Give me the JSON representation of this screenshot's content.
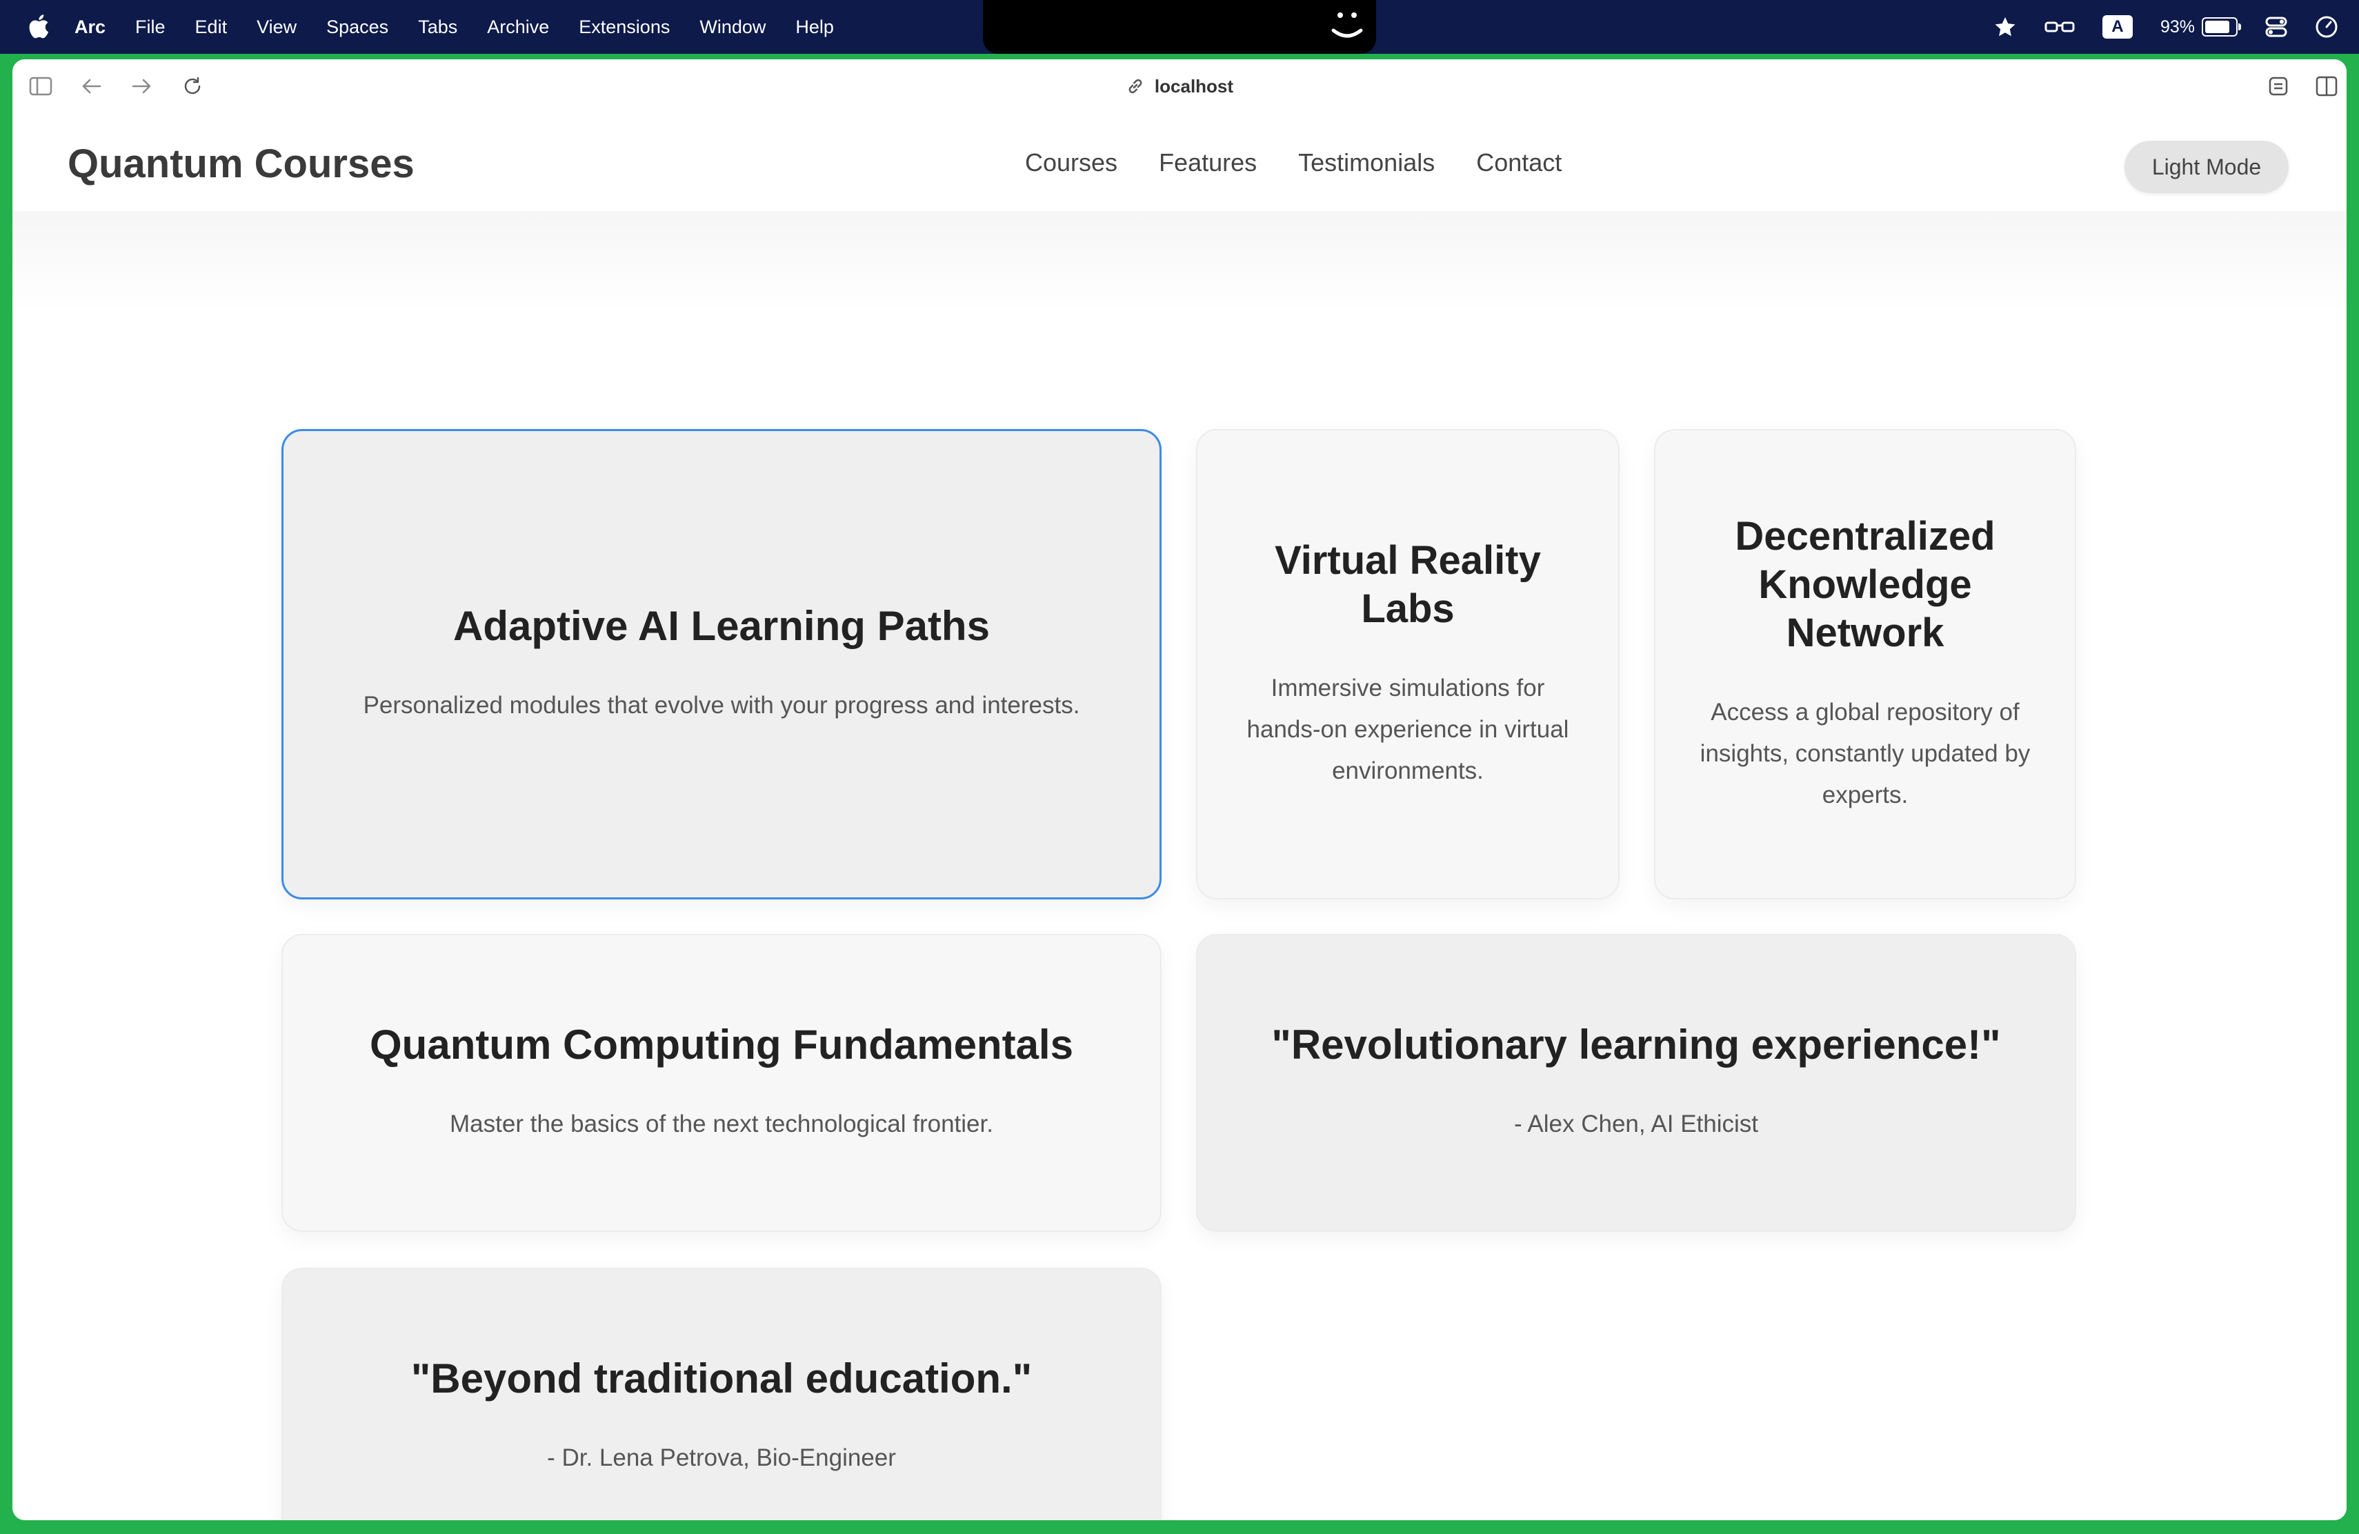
{
  "menubar": {
    "app": "Arc",
    "items": [
      "File",
      "Edit",
      "View",
      "Spaces",
      "Tabs",
      "Archive",
      "Extensions",
      "Window",
      "Help"
    ],
    "battery": "93%",
    "battery_level": 0.93,
    "input_source": "A"
  },
  "browser": {
    "url": "localhost"
  },
  "site": {
    "logo": "Quantum Courses",
    "nav": [
      "Courses",
      "Features",
      "Testimonials",
      "Contact"
    ],
    "mode_button": "Light Mode"
  },
  "cards": [
    {
      "title": "Adaptive AI Learning Paths",
      "text": "Personalized modules that evolve with your progress and interests."
    },
    {
      "title": "Virtual Reality Labs",
      "text": "Immersive simulations for hands-on experience in virtual environments."
    },
    {
      "title": "Decentralized Knowledge Network",
      "text": "Access a global repository of insights, constantly updated by experts."
    },
    {
      "title": "Quantum Computing Fundamentals",
      "text": "Master the basics of the next technological frontier."
    },
    {
      "title": "\"Revolutionary learning experience!\"",
      "text": "- Alex Chen, AI Ethicist"
    },
    {
      "title": "\"Beyond traditional education.\"",
      "text": "- Dr. Lena Petrova, Bio-Engineer"
    }
  ],
  "colors": {
    "window_border": "#22b14c",
    "menubar": "#0d1a4a",
    "active_card_border": "#3b8be6"
  }
}
